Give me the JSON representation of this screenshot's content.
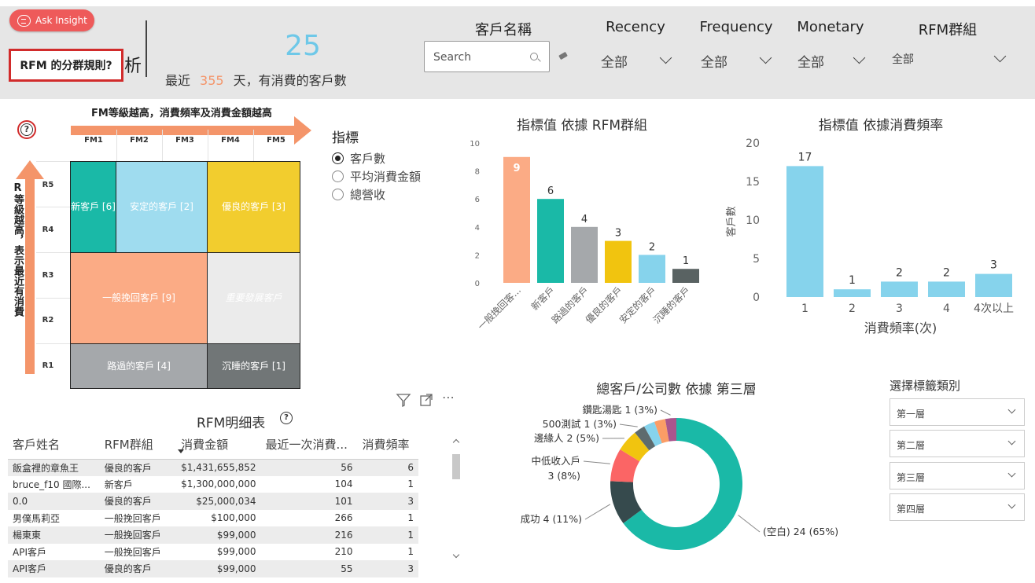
{
  "header": {
    "ask_insight": "Ask Insight",
    "rfm_rule": "RFM 的分群規則?",
    "title_fragment": "析",
    "customer_count": "25",
    "recent_prefix": "最近",
    "recent_days": "355",
    "recent_suffix": "天，有消費的客戶數",
    "accent_color": "#f4956a",
    "count_color": "#6ec8e8"
  },
  "slicers": {
    "customer_name": {
      "title": "客戶名稱",
      "placeholder": "Search"
    },
    "recency": {
      "title": "Recency",
      "value": "全部"
    },
    "frequency": {
      "title": "Frequency",
      "value": "全部"
    },
    "monetary": {
      "title": "Monetary",
      "value": "全部"
    },
    "group": {
      "title": "RFM群組",
      "value": "全部"
    }
  },
  "rfm_grid": {
    "fm_caption": "FM等級越高，消費頻率及消費金額越高",
    "r_caption": "R等級越高，表示最近有消費",
    "columns": [
      "FM1",
      "FM2",
      "FM3",
      "FM4",
      "FM5"
    ],
    "rows": [
      "R5",
      "R4",
      "R3",
      "R2",
      "R1"
    ],
    "segments": {
      "new": "新客戶 [6]",
      "stable": "安定的客戶 [2]",
      "good": "優良的客戶 [3]",
      "winback": "一般挽回客戶 [9]",
      "develop": "重要發展客戶",
      "passing": "路過的客戶 [4]",
      "sleeping": "沉睡的客戶 [1]"
    }
  },
  "metric_selector": {
    "title": "指標",
    "options": [
      "客戶數",
      "平均消費金額",
      "總營收"
    ],
    "selected": "客戶數"
  },
  "chart_by_group": {
    "title": "指標值 依據 RFM群組",
    "chart_data": {
      "type": "bar",
      "categories": [
        "一般挽回客...",
        "新客戶",
        "路過的客戶",
        "優良的客戶",
        "安定的客戶",
        "沉睡的客戶"
      ],
      "values": [
        9,
        6,
        4,
        3,
        2,
        1
      ],
      "colors": [
        "#fbab85",
        "#1ab9a7",
        "#a5a8ab",
        "#f1c40f",
        "#86d3ec",
        "#596262"
      ],
      "ylim": [
        0,
        10
      ],
      "yticks": [
        0,
        2,
        4,
        6,
        8,
        10
      ]
    }
  },
  "chart_by_freq": {
    "title": "指標值 依據消費頻率",
    "chart_data": {
      "type": "bar",
      "categories": [
        "1",
        "2",
        "3",
        "4",
        "4次以上"
      ],
      "values": [
        17,
        1,
        2,
        2,
        3
      ],
      "color": "#86d3ec",
      "xlabel": "消費頻率(次)",
      "ylabel": "客戶數",
      "ylim": [
        0,
        20
      ],
      "yticks": [
        0,
        5,
        10,
        15,
        20
      ]
    }
  },
  "table": {
    "title": "RFM明细表",
    "columns": [
      "客戶姓名",
      "RFM群組",
      "消費金額",
      "最近一次消費...",
      "消費頻率"
    ],
    "rows": [
      [
        "飯盒裡的章魚王",
        "優良的客戶",
        "$1,431,655,852",
        "56",
        "6"
      ],
      [
        "bruce_f10 國際...",
        "新客戶",
        "$1,300,000,000",
        "104",
        "1"
      ],
      [
        "0.0",
        "優良的客戶",
        "$25,000,034",
        "101",
        "3"
      ],
      [
        "男僕馬莉亞",
        "一般挽回客戶",
        "$100,000",
        "266",
        "1"
      ],
      [
        "楊東東",
        "一般挽回客戶",
        "$99,000",
        "216",
        "1"
      ],
      [
        "API客戶",
        "一般挽回客戶",
        "$99,000",
        "210",
        "1"
      ],
      [
        "API客戶",
        "優良的客戶",
        "$99,000",
        "55",
        "3"
      ]
    ]
  },
  "donut": {
    "title": "總客戶/公司數 依據 第三層",
    "chart_data": {
      "type": "pie",
      "slices": [
        {
          "label": "(空白)",
          "value": 24,
          "pct": "65%",
          "color": "#1ab9a7"
        },
        {
          "label": "成功",
          "value": 4,
          "pct": "11%",
          "color": "#364a4d"
        },
        {
          "label": "中低收入戶",
          "value": 3,
          "pct": "8%",
          "color": "#fb6565"
        },
        {
          "label": "邊緣人",
          "value": 2,
          "pct": "5%",
          "color": "#f1c40f"
        },
        {
          "label": "500測試",
          "value": 1,
          "pct": "3%",
          "color": "#5e6b6e"
        },
        {
          "label": "",
          "value": 1,
          "pct": "",
          "color": "#86d3ec"
        },
        {
          "label": "",
          "value": 1,
          "pct": "",
          "color": "#fb9d66"
        },
        {
          "label": "鑽匙湯匙",
          "value": 1,
          "pct": "3%",
          "color": "#a9558d"
        }
      ]
    },
    "labels": {
      "blank": "(空白) 24 (65%)",
      "success": "成功 4 (11%)",
      "lowincome_1": "中低收入戶",
      "lowincome_2": "3 (8%)",
      "edge": "邊緣人 2 (5%)",
      "test": "500測試 1 (3%)",
      "spoon": "鑽匙湯匙 1 (3%)"
    }
  },
  "tag_slicer": {
    "title": "選擇標籤類別",
    "options": [
      "第一層",
      "第二層",
      "第三層",
      "第四層"
    ]
  }
}
